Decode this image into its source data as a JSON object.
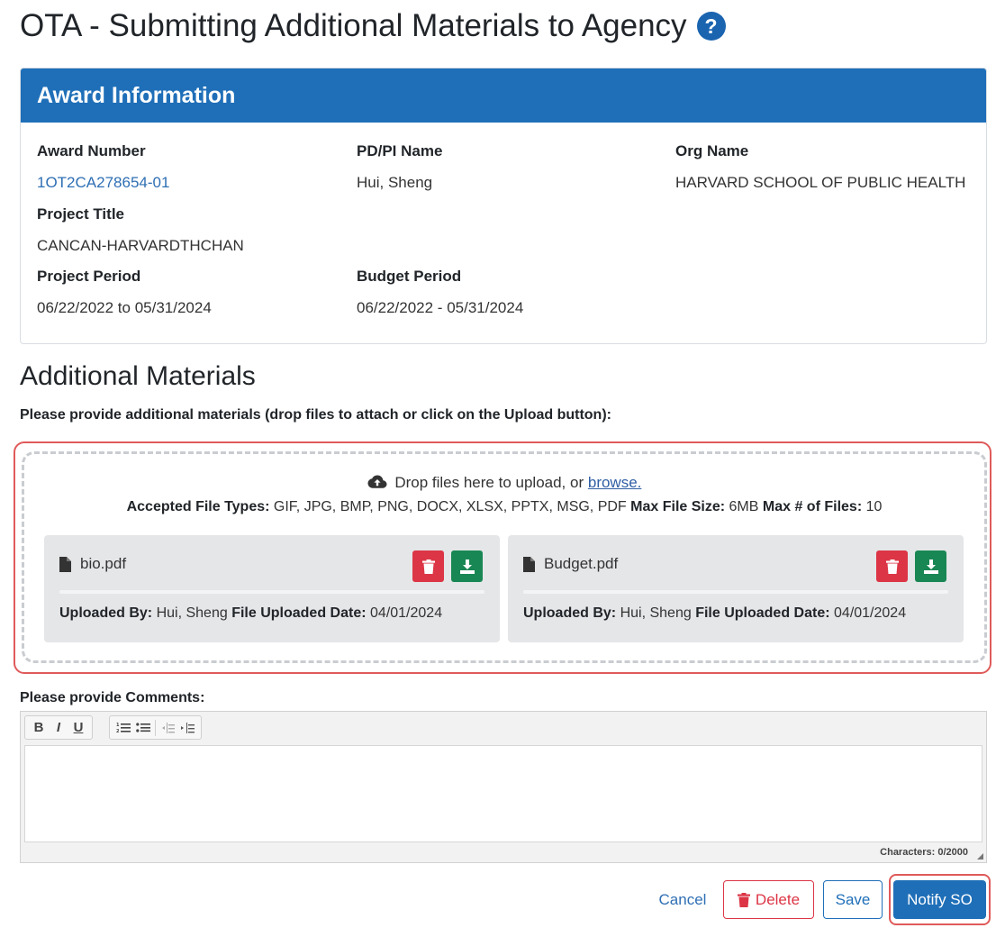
{
  "page": {
    "title": "OTA - Submitting Additional Materials to Agency"
  },
  "award": {
    "header": "Award Information",
    "award_number_label": "Award Number",
    "award_number": "1OT2CA278654-01",
    "pdpi_label": "PD/PI Name",
    "pdpi": "Hui, Sheng",
    "org_label": "Org Name",
    "org": "HARVARD SCHOOL OF PUBLIC HEALTH",
    "project_title_label": "Project Title",
    "project_title": "CANCAN-HARVARDTHCHAN",
    "project_period_label": "Project Period",
    "project_period": "06/22/2022 to 05/31/2024",
    "budget_period_label": "Budget Period",
    "budget_period": "06/22/2022 - 05/31/2024"
  },
  "materials": {
    "title": "Additional Materials",
    "instruction": "Please provide additional materials (drop files to attach or click on the Upload button):",
    "drop_text": "Drop files here to upload, or",
    "browse_link": "browse.",
    "types_label": "Accepted File Types:",
    "types": "GIF, JPG, BMP, PNG, DOCX, XLSX, PPTX, MSG, PDF",
    "max_size_label": "Max File Size:",
    "max_size": "6MB",
    "max_files_label": "Max # of Files:",
    "max_files": "10",
    "files": [
      {
        "name": "bio.pdf",
        "uploaded_by_label": "Uploaded By:",
        "uploaded_by": "Hui, Sheng",
        "date_label": "File Uploaded Date:",
        "date": "04/01/2024"
      },
      {
        "name": "Budget.pdf",
        "uploaded_by_label": "Uploaded By:",
        "uploaded_by": "Hui, Sheng",
        "date_label": "File Uploaded Date:",
        "date": "04/01/2024"
      }
    ]
  },
  "comments": {
    "label": "Please provide Comments:",
    "char_count": "Characters: 0/2000",
    "toolbar": {
      "bold": "B",
      "italic": "I",
      "underline": "U"
    }
  },
  "actions": {
    "cancel": "Cancel",
    "delete": "Delete",
    "save": "Save",
    "notify": "Notify SO"
  },
  "colors": {
    "primary": "#1f6fb8",
    "danger": "#dc3545",
    "success": "#198754",
    "highlight": "#e05a5a"
  }
}
